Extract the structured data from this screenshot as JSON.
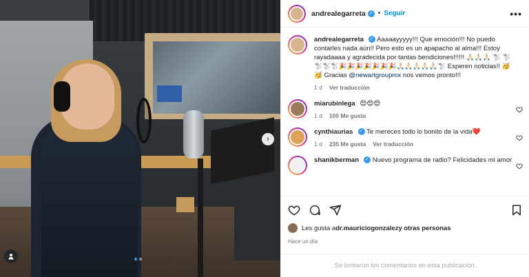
{
  "post": {
    "username": "andrealegarreta",
    "separator": "•",
    "follow_label": "Seguir",
    "more_label": "•••",
    "nav_next": "›",
    "carousel": {
      "count": 2,
      "active": 0
    }
  },
  "caption": {
    "username": "andrealegarreta",
    "text_1": "Aaaaayyyyy!!! Que emoción!!! No puedo contarles nada aún!! Pero esto es un apapacho al alma!!! Estoy rayadaaaa y agradecida por tantas bendiciones!!!!!! 🙏🏻🙏🏻🙏🏻 🐩 🐩🐩🐩🐩🎉🎉🎉🎉🎉🎉🎉🙏🏻🙏🏻🙏🏻🙏🏻🙏🏻🐩 Esperen noticias!! 🥳🥳 Gracias ",
    "mention": "@newartgroupmx",
    "text_2": " nos vemos pronto!!!",
    "time": "1 d",
    "translate": "Ver traducción"
  },
  "comments": [
    {
      "username": "miarubinlega",
      "text": "😍😍😍",
      "time": "1 d",
      "likes": "100 Me gusta",
      "translate": ""
    },
    {
      "username": "cynthiaurias",
      "text": "Te mereces todo lo bonito de la vida❤️",
      "time": "1 d",
      "likes": "235 Me gusta",
      "translate": "Ver traducción"
    },
    {
      "username": "shanikberman",
      "text": "Nuevo programa de radio? Felicidades mi amor",
      "time": "",
      "likes": "",
      "translate": ""
    }
  ],
  "likes": {
    "prefix": "Les gusta a ",
    "user": "dr.mauriciogonzalez",
    "suffix": " y otras personas"
  },
  "timestamp": "Hace un día",
  "comments_limited": "Se limitaron los comentarios en esta publicación.",
  "colors": {
    "accent": "#0095f6",
    "verified": "#3897f0",
    "heart": "#ed4956"
  }
}
